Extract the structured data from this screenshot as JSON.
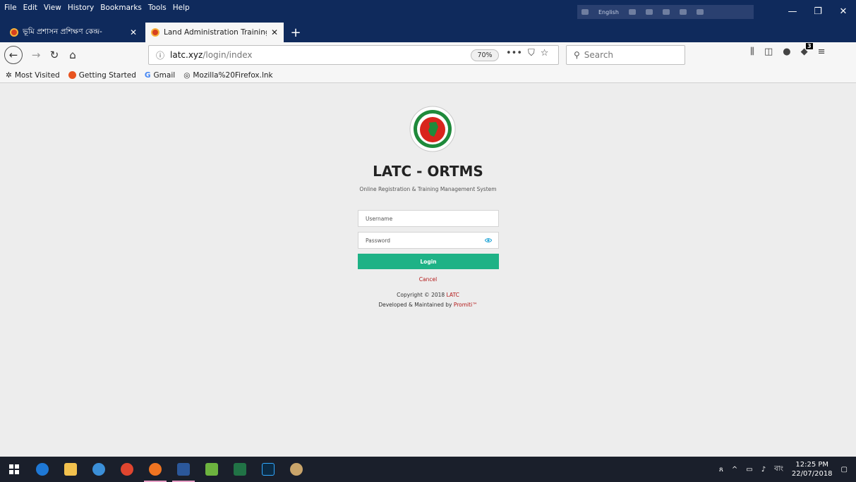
{
  "browser": {
    "menu": [
      "File",
      "Edit",
      "View",
      "History",
      "Bookmarks",
      "Tools",
      "Help"
    ],
    "lang_indicator": "English",
    "window_controls": [
      "—",
      "❐",
      "✕"
    ],
    "tabs": [
      {
        "title": "ভূমি প্রশাসন প্রশিক্ষণ কেন্দ্র-",
        "close": "✕",
        "active": false
      },
      {
        "title": "Land Administration Training C",
        "close": "✕",
        "active": true
      }
    ],
    "new_tab": "+",
    "url_host": "latc.xyz",
    "url_path": "/login/index",
    "zoom": "70%",
    "search_placeholder": "Search",
    "extension_badge": "3",
    "bookmarks": [
      {
        "label": "Most Visited",
        "icon": "gear-icon"
      },
      {
        "label": "Getting Started",
        "icon": "firefox-icon"
      },
      {
        "label": "Gmail",
        "icon": "google-icon"
      },
      {
        "label": "Mozilla%20Firefox.lnk",
        "icon": "globe-icon"
      }
    ]
  },
  "page": {
    "title": "LATC - ORTMS",
    "subtitle": "Online Registration & Training Management System",
    "username_placeholder": "Username",
    "password_placeholder": "Password",
    "login_label": "Login",
    "cancel_label": "Cancel",
    "copyright_prefix": "Copyright © 2018 ",
    "copyright_link": "LATC",
    "developed_prefix": "Developed & Maintained by ",
    "developed_link": "Promiti™"
  },
  "taskbar": {
    "time": "12:25 PM",
    "date": "22/07/2018",
    "lang": "বাং"
  },
  "colors": {
    "titlebar": "#0f2a5c",
    "login_button": "#1eb286",
    "link_red": "#b31717"
  }
}
